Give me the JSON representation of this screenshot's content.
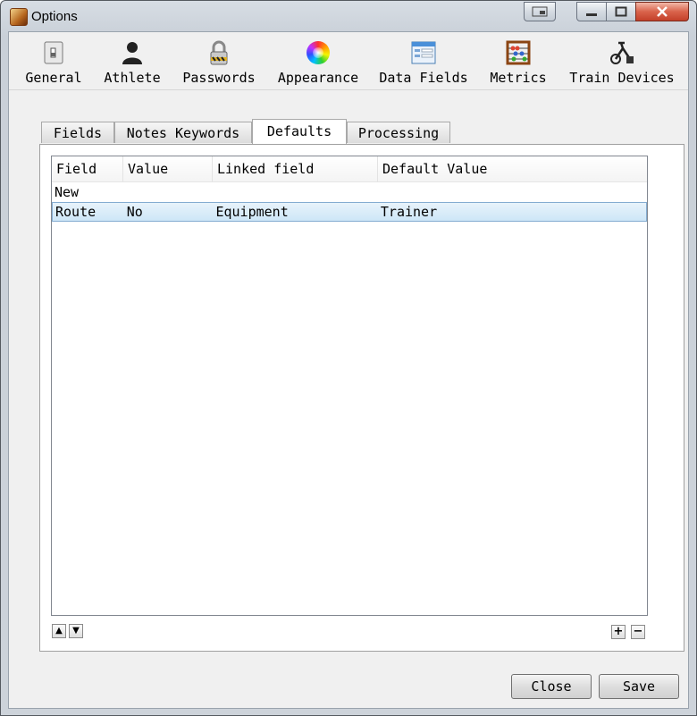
{
  "window": {
    "title": "Options"
  },
  "toolbar": {
    "items": [
      {
        "label": "General",
        "icon": "switch-icon"
      },
      {
        "label": "Athlete",
        "icon": "athlete-icon"
      },
      {
        "label": "Passwords",
        "icon": "padlock-icon"
      },
      {
        "label": "Appearance",
        "icon": "color-wheel-icon"
      },
      {
        "label": "Data Fields",
        "icon": "data-fields-icon"
      },
      {
        "label": "Metrics",
        "icon": "abacus-icon"
      },
      {
        "label": "Train Devices",
        "icon": "trainer-icon"
      }
    ]
  },
  "tabs": [
    {
      "label": "Fields"
    },
    {
      "label": "Notes Keywords"
    },
    {
      "label": "Defaults",
      "active": true
    },
    {
      "label": "Processing"
    }
  ],
  "table": {
    "headers": [
      "Field",
      "Value",
      "Linked field",
      "Default Value"
    ],
    "rows": [
      {
        "field": "New",
        "value": "",
        "linked": "",
        "default": ""
      },
      {
        "field": "Route",
        "value": "No",
        "linked": "Equipment",
        "default": "Trainer",
        "selected": true
      }
    ]
  },
  "list_buttons": {
    "up": "▲",
    "down": "▼",
    "add": "+",
    "remove": "−"
  },
  "footer": {
    "close_label": "Close",
    "save_label": "Save"
  }
}
